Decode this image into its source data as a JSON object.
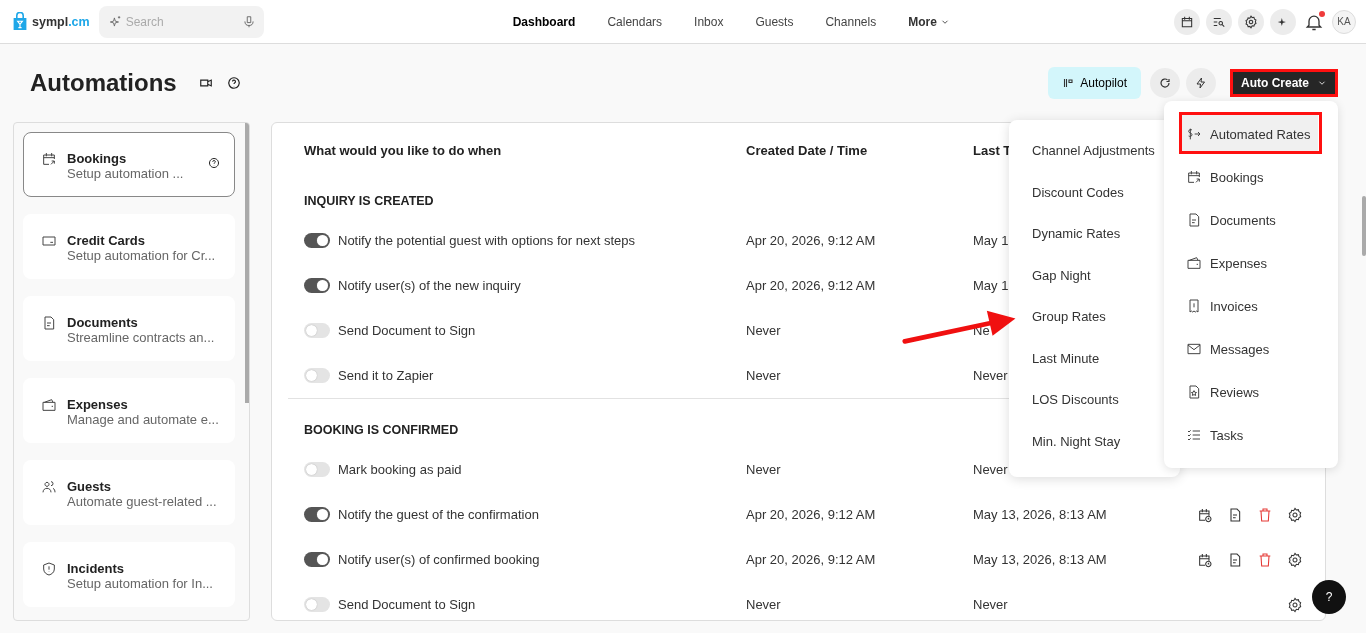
{
  "header": {
    "logo": {
      "text": "sympl",
      "accent": ".cm"
    },
    "search": {
      "placeholder": "Search"
    },
    "nav": [
      {
        "label": "Dashboard",
        "selected": true,
        "kind": "link"
      },
      {
        "label": "Calendars",
        "selected": false,
        "kind": "link"
      },
      {
        "label": "Inbox",
        "selected": false,
        "kind": "link"
      },
      {
        "label": "Guests",
        "selected": false,
        "kind": "link"
      },
      {
        "label": "Channels",
        "selected": false,
        "kind": "link"
      },
      {
        "label": "More",
        "selected": false,
        "kind": "dropdown"
      }
    ],
    "notifications": {
      "unread": true
    },
    "avatar": "KA"
  },
  "page": {
    "title": "Automations",
    "autopilot": "Autopilot",
    "auto_create": "Auto Create"
  },
  "sidebar": {
    "items": [
      {
        "kind": "bookings",
        "title": "Bookings",
        "subtitle": "Setup automation ...",
        "selected": true,
        "help": true
      },
      {
        "kind": "card",
        "title": "Credit Cards",
        "subtitle": "Setup automation for Cr...",
        "selected": false,
        "help": false
      },
      {
        "kind": "document",
        "title": "Documents",
        "subtitle": "Streamline contracts an...",
        "selected": false,
        "help": false
      },
      {
        "kind": "wallet",
        "title": "Expenses",
        "subtitle": "Manage and automate e...",
        "selected": false,
        "help": false
      },
      {
        "kind": "users",
        "title": "Guests",
        "subtitle": "Automate guest-related ...",
        "selected": false,
        "help": false
      },
      {
        "kind": "shield",
        "title": "Incidents",
        "subtitle": "Setup automation for In...",
        "selected": false,
        "help": false
      }
    ]
  },
  "table": {
    "columns": [
      "What would you like to do when",
      "Created Date / Time",
      "Last T"
    ],
    "sections": [
      {
        "title": "INQUIRY IS CREATED",
        "rows": [
          {
            "label": "Notify the potential guest with options for next steps",
            "on": true,
            "created": "Apr 20, 2026, 9:12 AM",
            "last": "May 1"
          },
          {
            "label": "Notify user(s) of the new inquiry",
            "on": true,
            "created": "Apr 20, 2026, 9:12 AM",
            "last": "May 1"
          },
          {
            "label": "Send Document to Sign",
            "on": false,
            "created": "Never",
            "last": "Ne"
          },
          {
            "label": "Send it to Zapier",
            "on": false,
            "created": "Never",
            "last": "Never"
          }
        ]
      },
      {
        "title": "BOOKING IS CONFIRMED",
        "rows": [
          {
            "label": "Mark booking as paid",
            "on": false,
            "created": "Never",
            "last": "Never"
          },
          {
            "label": "Notify the guest of the confirmation",
            "on": true,
            "created": "Apr 20, 2026, 9:12 AM",
            "last": "May 13, 2026, 8:13 AM",
            "actions": [
              {
                "kind": "schedule"
              },
              {
                "kind": "document"
              },
              {
                "kind": "delete"
              },
              {
                "kind": "settings"
              }
            ]
          },
          {
            "label": "Notify user(s) of confirmed booking",
            "on": true,
            "created": "Apr 20, 2026, 9:12 AM",
            "last": "May 13, 2026, 8:13 AM",
            "actions": [
              {
                "kind": "schedule"
              },
              {
                "kind": "document"
              },
              {
                "kind": "delete"
              },
              {
                "kind": "settings"
              }
            ]
          },
          {
            "label": "Send Document to Sign",
            "on": false,
            "created": "Never",
            "last": "Never",
            "actions": [
              {
                "kind": "settings"
              }
            ]
          }
        ]
      }
    ]
  },
  "menu": {
    "items": [
      {
        "kind": "rates",
        "label": "Automated Rates",
        "selected": true
      },
      {
        "kind": "bookings",
        "label": "Bookings",
        "selected": false
      },
      {
        "kind": "document",
        "label": "Documents",
        "selected": false
      },
      {
        "kind": "wallet",
        "label": "Expenses",
        "selected": false
      },
      {
        "kind": "invoice",
        "label": "Invoices",
        "selected": false
      },
      {
        "kind": "mail",
        "label": "Messages",
        "selected": false
      },
      {
        "kind": "review",
        "label": "Reviews",
        "selected": false
      },
      {
        "kind": "tasks",
        "label": "Tasks",
        "selected": false
      }
    ]
  },
  "submenu": {
    "items": [
      "Channel Adjustments",
      "Discount Codes",
      "Dynamic Rates",
      "Gap Night",
      "Group Rates",
      "Last Minute",
      "LOS Discounts",
      "Min. Night Stay"
    ]
  },
  "help_button": "?"
}
